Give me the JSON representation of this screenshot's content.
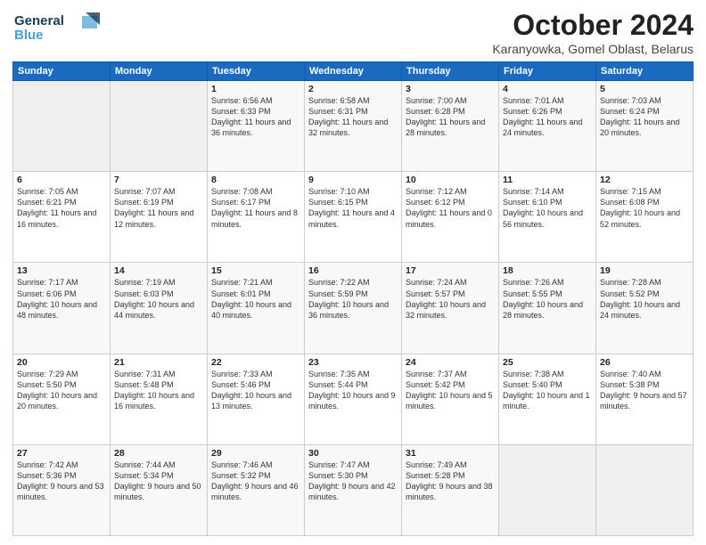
{
  "header": {
    "logo_line1": "General",
    "logo_line2": "Blue",
    "month": "October 2024",
    "location": "Karanyowka, Gomel Oblast, Belarus"
  },
  "days_of_week": [
    "Sunday",
    "Monday",
    "Tuesday",
    "Wednesday",
    "Thursday",
    "Friday",
    "Saturday"
  ],
  "weeks": [
    [
      {
        "day": "",
        "empty": true
      },
      {
        "day": "",
        "empty": true
      },
      {
        "day": "1",
        "sunrise": "Sunrise: 6:56 AM",
        "sunset": "Sunset: 6:33 PM",
        "daylight": "Daylight: 11 hours and 36 minutes."
      },
      {
        "day": "2",
        "sunrise": "Sunrise: 6:58 AM",
        "sunset": "Sunset: 6:31 PM",
        "daylight": "Daylight: 11 hours and 32 minutes."
      },
      {
        "day": "3",
        "sunrise": "Sunrise: 7:00 AM",
        "sunset": "Sunset: 6:28 PM",
        "daylight": "Daylight: 11 hours and 28 minutes."
      },
      {
        "day": "4",
        "sunrise": "Sunrise: 7:01 AM",
        "sunset": "Sunset: 6:26 PM",
        "daylight": "Daylight: 11 hours and 24 minutes."
      },
      {
        "day": "5",
        "sunrise": "Sunrise: 7:03 AM",
        "sunset": "Sunset: 6:24 PM",
        "daylight": "Daylight: 11 hours and 20 minutes."
      }
    ],
    [
      {
        "day": "6",
        "sunrise": "Sunrise: 7:05 AM",
        "sunset": "Sunset: 6:21 PM",
        "daylight": "Daylight: 11 hours and 16 minutes."
      },
      {
        "day": "7",
        "sunrise": "Sunrise: 7:07 AM",
        "sunset": "Sunset: 6:19 PM",
        "daylight": "Daylight: 11 hours and 12 minutes."
      },
      {
        "day": "8",
        "sunrise": "Sunrise: 7:08 AM",
        "sunset": "Sunset: 6:17 PM",
        "daylight": "Daylight: 11 hours and 8 minutes."
      },
      {
        "day": "9",
        "sunrise": "Sunrise: 7:10 AM",
        "sunset": "Sunset: 6:15 PM",
        "daylight": "Daylight: 11 hours and 4 minutes."
      },
      {
        "day": "10",
        "sunrise": "Sunrise: 7:12 AM",
        "sunset": "Sunset: 6:12 PM",
        "daylight": "Daylight: 11 hours and 0 minutes."
      },
      {
        "day": "11",
        "sunrise": "Sunrise: 7:14 AM",
        "sunset": "Sunset: 6:10 PM",
        "daylight": "Daylight: 10 hours and 56 minutes."
      },
      {
        "day": "12",
        "sunrise": "Sunrise: 7:15 AM",
        "sunset": "Sunset: 6:08 PM",
        "daylight": "Daylight: 10 hours and 52 minutes."
      }
    ],
    [
      {
        "day": "13",
        "sunrise": "Sunrise: 7:17 AM",
        "sunset": "Sunset: 6:06 PM",
        "daylight": "Daylight: 10 hours and 48 minutes."
      },
      {
        "day": "14",
        "sunrise": "Sunrise: 7:19 AM",
        "sunset": "Sunset: 6:03 PM",
        "daylight": "Daylight: 10 hours and 44 minutes."
      },
      {
        "day": "15",
        "sunrise": "Sunrise: 7:21 AM",
        "sunset": "Sunset: 6:01 PM",
        "daylight": "Daylight: 10 hours and 40 minutes."
      },
      {
        "day": "16",
        "sunrise": "Sunrise: 7:22 AM",
        "sunset": "Sunset: 5:59 PM",
        "daylight": "Daylight: 10 hours and 36 minutes."
      },
      {
        "day": "17",
        "sunrise": "Sunrise: 7:24 AM",
        "sunset": "Sunset: 5:57 PM",
        "daylight": "Daylight: 10 hours and 32 minutes."
      },
      {
        "day": "18",
        "sunrise": "Sunrise: 7:26 AM",
        "sunset": "Sunset: 5:55 PM",
        "daylight": "Daylight: 10 hours and 28 minutes."
      },
      {
        "day": "19",
        "sunrise": "Sunrise: 7:28 AM",
        "sunset": "Sunset: 5:52 PM",
        "daylight": "Daylight: 10 hours and 24 minutes."
      }
    ],
    [
      {
        "day": "20",
        "sunrise": "Sunrise: 7:29 AM",
        "sunset": "Sunset: 5:50 PM",
        "daylight": "Daylight: 10 hours and 20 minutes."
      },
      {
        "day": "21",
        "sunrise": "Sunrise: 7:31 AM",
        "sunset": "Sunset: 5:48 PM",
        "daylight": "Daylight: 10 hours and 16 minutes."
      },
      {
        "day": "22",
        "sunrise": "Sunrise: 7:33 AM",
        "sunset": "Sunset: 5:46 PM",
        "daylight": "Daylight: 10 hours and 13 minutes."
      },
      {
        "day": "23",
        "sunrise": "Sunrise: 7:35 AM",
        "sunset": "Sunset: 5:44 PM",
        "daylight": "Daylight: 10 hours and 9 minutes."
      },
      {
        "day": "24",
        "sunrise": "Sunrise: 7:37 AM",
        "sunset": "Sunset: 5:42 PM",
        "daylight": "Daylight: 10 hours and 5 minutes."
      },
      {
        "day": "25",
        "sunrise": "Sunrise: 7:38 AM",
        "sunset": "Sunset: 5:40 PM",
        "daylight": "Daylight: 10 hours and 1 minute."
      },
      {
        "day": "26",
        "sunrise": "Sunrise: 7:40 AM",
        "sunset": "Sunset: 5:38 PM",
        "daylight": "Daylight: 9 hours and 57 minutes."
      }
    ],
    [
      {
        "day": "27",
        "sunrise": "Sunrise: 7:42 AM",
        "sunset": "Sunset: 5:36 PM",
        "daylight": "Daylight: 9 hours and 53 minutes."
      },
      {
        "day": "28",
        "sunrise": "Sunrise: 7:44 AM",
        "sunset": "Sunset: 5:34 PM",
        "daylight": "Daylight: 9 hours and 50 minutes."
      },
      {
        "day": "29",
        "sunrise": "Sunrise: 7:46 AM",
        "sunset": "Sunset: 5:32 PM",
        "daylight": "Daylight: 9 hours and 46 minutes."
      },
      {
        "day": "30",
        "sunrise": "Sunrise: 7:47 AM",
        "sunset": "Sunset: 5:30 PM",
        "daylight": "Daylight: 9 hours and 42 minutes."
      },
      {
        "day": "31",
        "sunrise": "Sunrise: 7:49 AM",
        "sunset": "Sunset: 5:28 PM",
        "daylight": "Daylight: 9 hours and 38 minutes."
      },
      {
        "day": "",
        "empty": true
      },
      {
        "day": "",
        "empty": true
      }
    ]
  ]
}
